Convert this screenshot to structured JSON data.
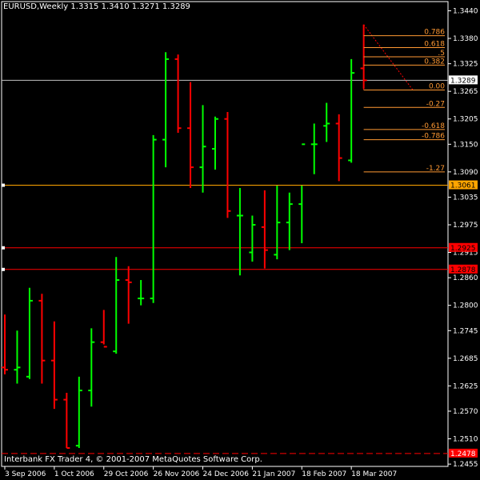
{
  "header": {
    "symbol_label": "EURUSD,Weekly",
    "ohlc_label": "1.3315 1.3410 1.3271 1.3289"
  },
  "footer": {
    "copyright": "Interbank FX Trader 4, © 2001-2007 MetaQuotes Software Corp."
  },
  "colors": {
    "background": "#000000",
    "bull": "#00ff00",
    "bear": "#ff0000",
    "axis": "#ffffff",
    "fib": "#ff9933",
    "bid_line": "#c0c0c0",
    "hline_orange": "#ffa500",
    "hline_red": "#ff0000"
  },
  "chart_data": {
    "type": "ohlc",
    "symbol": "EURUSD",
    "timeframe": "Weekly",
    "ylim": [
      1.245,
      1.346
    ],
    "y_ticks": [
      "1.3440",
      "1.3380",
      "1.3325",
      "1.3265",
      "1.3205",
      "1.3150",
      "1.3090",
      "1.3035",
      "1.2975",
      "1.2915",
      "1.2860",
      "1.2800",
      "1.2745",
      "1.2685",
      "1.2625",
      "1.2570",
      "1.2510",
      "1.2455"
    ],
    "x_labels": [
      "3 Sep 2006",
      "1 Oct 2006",
      "29 Oct 2006",
      "26 Nov 2006",
      "24 Dec 2006",
      "21 Jan 2007",
      "18 Feb 2007",
      "18 Mar 2007"
    ],
    "bars": [
      {
        "o": 1.2665,
        "h": 1.278,
        "l": 1.265,
        "c": 1.266
      },
      {
        "o": 1.266,
        "h": 1.2745,
        "l": 1.263,
        "c": 1.2665
      },
      {
        "o": 1.2645,
        "h": 1.2838,
        "l": 1.264,
        "c": 1.281
      },
      {
        "o": 1.281,
        "h": 1.2825,
        "l": 1.263,
        "c": 1.268
      },
      {
        "o": 1.268,
        "h": 1.2765,
        "l": 1.2575,
        "c": 1.2595
      },
      {
        "o": 1.2595,
        "h": 1.261,
        "l": 1.249,
        "c": 1.249
      },
      {
        "o": 1.2495,
        "h": 1.2645,
        "l": 1.249,
        "c": 1.2615
      },
      {
        "o": 1.2615,
        "h": 1.275,
        "l": 1.258,
        "c": 1.272
      },
      {
        "o": 1.272,
        "h": 1.279,
        "l": 1.2715,
        "c": 1.271
      },
      {
        "o": 1.27,
        "h": 1.2905,
        "l": 1.2695,
        "c": 1.2855
      },
      {
        "o": 1.2855,
        "h": 1.2885,
        "l": 1.276,
        "c": 1.285
      },
      {
        "o": 1.2815,
        "h": 1.2855,
        "l": 1.28,
        "c": 1.2815
      },
      {
        "o": 1.2815,
        "h": 1.317,
        "l": 1.2805,
        "c": 1.316
      },
      {
        "o": 1.316,
        "h": 1.335,
        "l": 1.31,
        "c": 1.3335
      },
      {
        "o": 1.3335,
        "h": 1.3345,
        "l": 1.3175,
        "c": 1.3185
      },
      {
        "o": 1.3185,
        "h": 1.3285,
        "l": 1.3055,
        "c": 1.31
      },
      {
        "o": 1.31,
        "h": 1.3235,
        "l": 1.3045,
        "c": 1.3145
      },
      {
        "o": 1.314,
        "h": 1.321,
        "l": 1.3095,
        "c": 1.3205
      },
      {
        "o": 1.3205,
        "h": 1.322,
        "l": 1.299,
        "c": 1.3005
      },
      {
        "o": 1.2995,
        "h": 1.3055,
        "l": 1.2865,
        "c": 1.2995
      },
      {
        "o": 1.2915,
        "h": 1.2995,
        "l": 1.2895,
        "c": 1.2975
      },
      {
        "o": 1.297,
        "h": 1.305,
        "l": 1.288,
        "c": 1.292
      },
      {
        "o": 1.291,
        "h": 1.306,
        "l": 1.29,
        "c": 1.298
      },
      {
        "o": 1.298,
        "h": 1.3045,
        "l": 1.292,
        "c": 1.302
      },
      {
        "o": 1.302,
        "h": 1.306,
        "l": 1.2935,
        "c": 1.315
      },
      {
        "o": 1.315,
        "h": 1.3195,
        "l": 1.3085,
        "c": 1.315
      },
      {
        "o": 1.319,
        "h": 1.324,
        "l": 1.3155,
        "c": 1.3195
      },
      {
        "o": 1.3195,
        "h": 1.3215,
        "l": 1.307,
        "c": 1.312
      },
      {
        "o": 1.3115,
        "h": 1.3335,
        "l": 1.311,
        "c": 1.3305
      },
      {
        "o": 1.3315,
        "h": 1.341,
        "l": 1.3271,
        "c": 1.3289
      }
    ],
    "fibonacci": [
      {
        "label": "0.786",
        "price": 1.3386
      },
      {
        "label": "0.618",
        "price": 1.336
      },
      {
        "label": ".5",
        "price": 1.334
      },
      {
        "label": "0.382",
        "price": 1.3322
      },
      {
        "label": "0.00",
        "price": 1.3268
      },
      {
        "label": "-0.27",
        "price": 1.323
      },
      {
        "label": "-0.618",
        "price": 1.3182
      },
      {
        "label": "-0.786",
        "price": 1.316
      },
      {
        "label": "-1.27",
        "price": 1.309
      }
    ],
    "horizontal_lines": [
      {
        "price": 1.3289,
        "label": "1.3289",
        "kind": "bid"
      },
      {
        "price": 1.3061,
        "label": "1.3061",
        "kind": "orange"
      },
      {
        "price": 1.2925,
        "label": "1.2925",
        "kind": "red"
      },
      {
        "price": 1.2878,
        "label": "1.2878",
        "kind": "red"
      },
      {
        "price": 1.2478,
        "label": "1.2478",
        "kind": "red-dashed"
      }
    ]
  }
}
